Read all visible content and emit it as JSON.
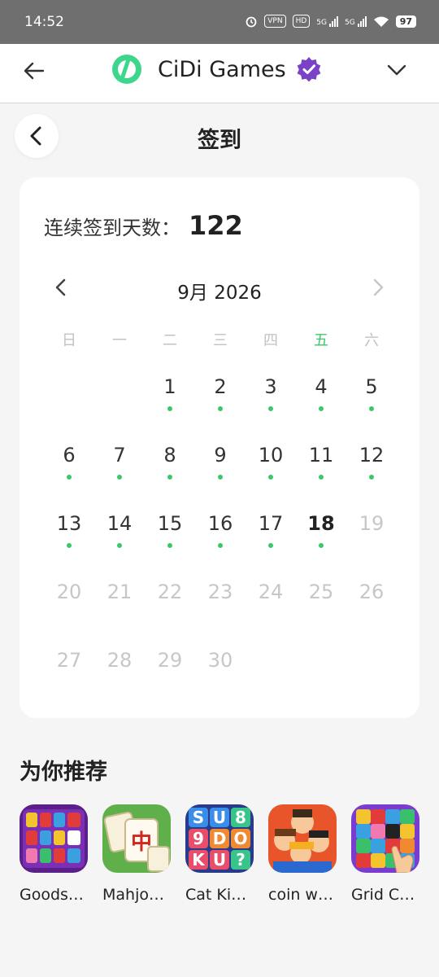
{
  "status_bar": {
    "time": "14:52",
    "vpn": "VPN",
    "hd": "HD",
    "net1": "5G",
    "net2": "5G",
    "battery": "97"
  },
  "app_bar": {
    "brand": "CiDi Games"
  },
  "page": {
    "title": "签到"
  },
  "streak": {
    "label": "连续签到天数：",
    "value": "122"
  },
  "calendar": {
    "month_label": "9月 2026",
    "weekdays": [
      "日",
      "一",
      "二",
      "三",
      "四",
      "五",
      "六"
    ],
    "today_weekday_index": 5,
    "first_weekday": 2,
    "days_in_month": 30,
    "today": 18,
    "signed_days": [
      1,
      2,
      3,
      4,
      5,
      6,
      7,
      8,
      9,
      10,
      11,
      12,
      13,
      14,
      15,
      16,
      17,
      18
    ],
    "colors": {
      "dot": "#3dc76a",
      "future": "#c7c7c7"
    }
  },
  "recommend": {
    "title": "为你推荐",
    "games": [
      {
        "name": "Goods…",
        "icon": "goods-sort-icon"
      },
      {
        "name": "Mahjo…",
        "icon": "mahjong-icon"
      },
      {
        "name": "Cat Ki…",
        "icon": "sudoku-icon"
      },
      {
        "name": "coin w…",
        "icon": "coin-wars-icon"
      },
      {
        "name": "Grid C…",
        "icon": "grid-blocks-icon"
      }
    ]
  }
}
